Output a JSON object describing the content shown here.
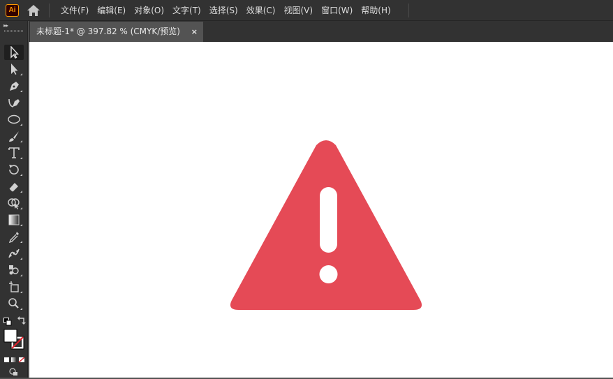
{
  "app": {
    "logo_text": "Ai",
    "home_icon": "home-icon"
  },
  "menu": [
    {
      "label": "文件(F)"
    },
    {
      "label": "编辑(E)"
    },
    {
      "label": "对象(O)"
    },
    {
      "label": "文字(T)"
    },
    {
      "label": "选择(S)"
    },
    {
      "label": "效果(C)"
    },
    {
      "label": "视图(V)"
    },
    {
      "label": "窗口(W)"
    },
    {
      "label": "帮助(H)"
    }
  ],
  "document_tab": {
    "title": "未标题-1* @ 397.82 % (CMYK/预览)",
    "close_label": "×"
  },
  "toolbar": {
    "collapse_label": "▸▸",
    "tools": [
      "selection-tool-icon",
      "direct-selection-tool-icon",
      "pen-tool-icon",
      "curvature-tool-icon",
      "ellipse-tool-icon",
      "paintbrush-tool-icon",
      "type-tool-icon",
      "rotate-tool-icon",
      "eraser-tool-icon",
      "shape-builder-tool-icon",
      "gradient-tool-icon",
      "eyedropper-tool-icon",
      "puppet-warp-tool-icon",
      "symbol-sprayer-tool-icon",
      "artboard-tool-icon",
      "zoom-tool-icon"
    ],
    "fill_color": "#ffffff",
    "stroke_color": "none"
  },
  "artwork": {
    "shape": "warning-triangle-icon",
    "fill": "#e54a56",
    "mark_fill": "#ffffff"
  },
  "colors": {
    "menubar": "#323232",
    "workspace": "#535353",
    "canvas": "#ffffff",
    "menu_text": "#dedede",
    "ai_logo_bg": "#330000",
    "ai_logo_fg": "#ff9a00"
  }
}
